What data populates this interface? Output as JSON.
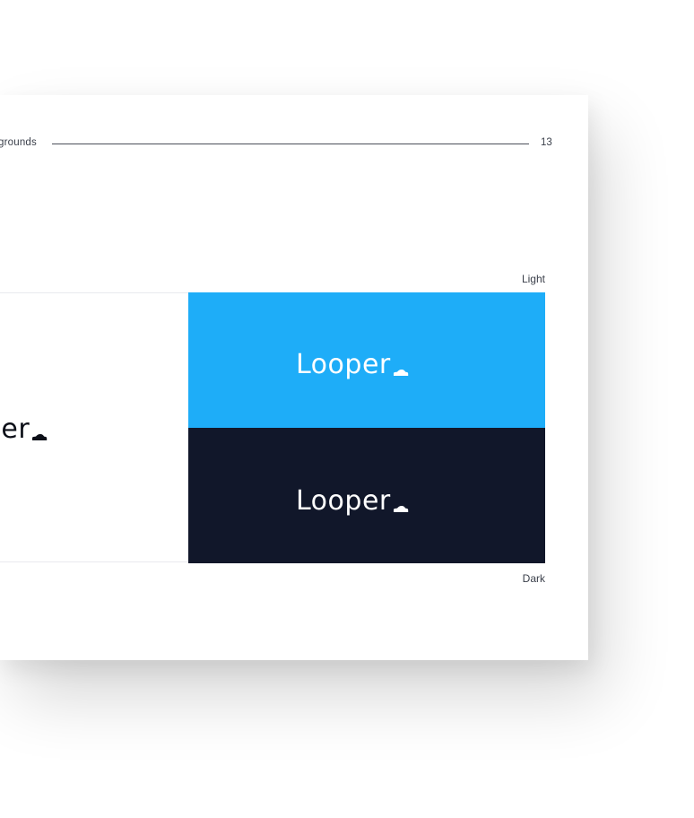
{
  "header": {
    "section_label": "grounds",
    "page_number": "13"
  },
  "labels": {
    "light": "Light",
    "dark": "Dark"
  },
  "logos": {
    "white_panel_text": "oper",
    "blue_panel_text": "Looper",
    "navy_panel_text": "Looper",
    "car_icon": "car-icon"
  },
  "colors": {
    "blue_background": "#1eadf8",
    "navy_background": "#11172a",
    "white_background": "#ffffff",
    "logo_dark": "#0c0f18",
    "logo_light": "#ffffff"
  }
}
